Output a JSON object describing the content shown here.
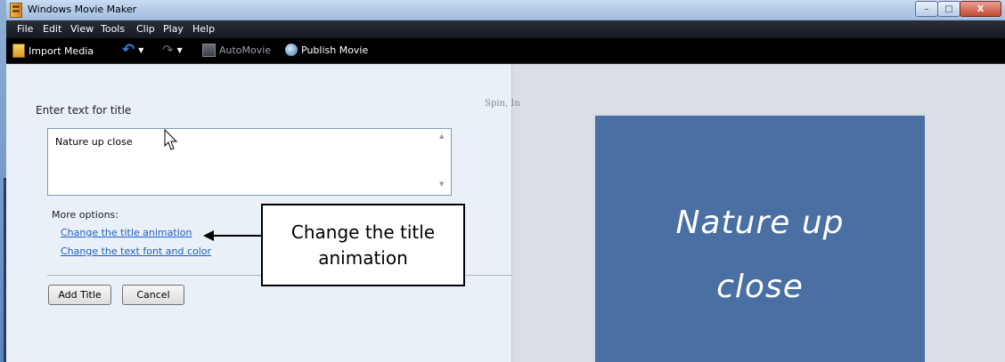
{
  "window": {
    "title": "Windows Movie Maker",
    "min_symbol": "–",
    "max_symbol": "□",
    "close_symbol": "X"
  },
  "menu": [
    "File",
    "Edit",
    "View",
    "Tools",
    "Clip",
    "Play",
    "Help"
  ],
  "toolbar": {
    "import_label": "Import Media",
    "automovie_label": "AutoMovie",
    "publish_label": "Publish Movie",
    "undo_icon": "undo-icon",
    "redo_icon": "redo-icon"
  },
  "title_editor": {
    "prompt": "Enter text for title",
    "text_value": "Nature up close",
    "more_options_label": "More options:",
    "link_animation": "Change the title animation",
    "link_font": "Change the text font and color",
    "add_button": "Add Title",
    "cancel_button": "Cancel"
  },
  "callout": {
    "text": "Change the title animation"
  },
  "preview": {
    "effect_label": "Spin, In",
    "line1": "Nature up",
    "line2": "close",
    "background_color": "#4a6fa3"
  }
}
